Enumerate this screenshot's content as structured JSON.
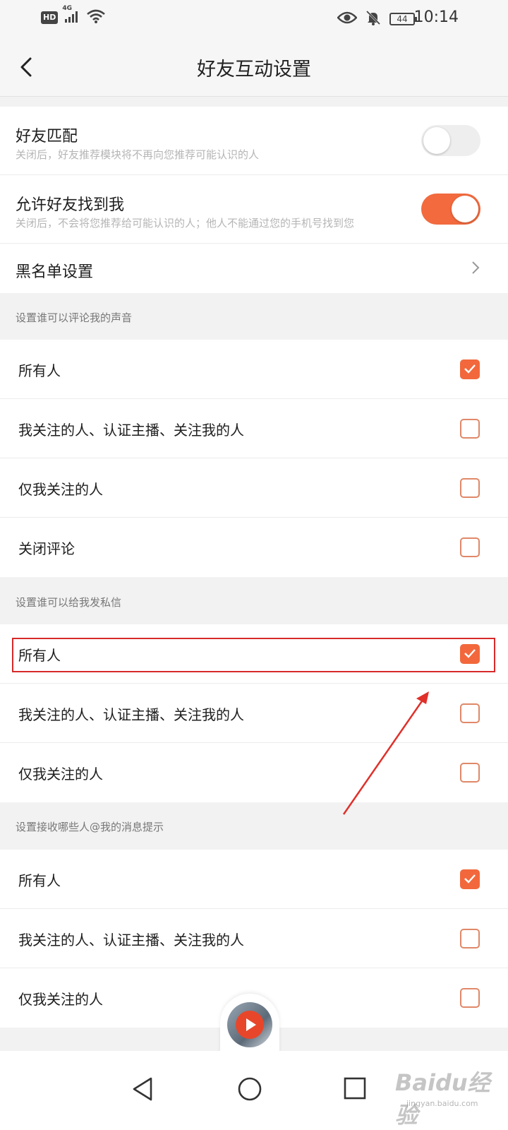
{
  "status_bar": {
    "hd": "HD",
    "network": "4G",
    "battery": "44",
    "time": "10:14"
  },
  "header": {
    "title": "好友互动设置"
  },
  "toggles": [
    {
      "title": "好友匹配",
      "subtitle": "关闭后，好友推荐模块将不再向您推荐可能认识的人",
      "enabled": false
    },
    {
      "title": "允许好友找到我",
      "subtitle": "关闭后，不会将您推荐给可能认识的人；他人不能通过您的手机号找到您",
      "enabled": true
    }
  ],
  "blacklist": {
    "label": "黑名单设置"
  },
  "sections": [
    {
      "label": "设置谁可以评论我的声音",
      "options": [
        {
          "label": "所有人",
          "checked": true
        },
        {
          "label": "我关注的人、认证主播、关注我的人",
          "checked": false
        },
        {
          "label": "仅我关注的人",
          "checked": false
        },
        {
          "label": "关闭评论",
          "checked": false
        }
      ]
    },
    {
      "label": "设置谁可以给我发私信",
      "options": [
        {
          "label": "所有人",
          "checked": true
        },
        {
          "label": "我关注的人、认证主播、关注我的人",
          "checked": false
        },
        {
          "label": "仅我关注的人",
          "checked": false
        }
      ]
    },
    {
      "label": "设置接收哪些人@我的消息提示",
      "options": [
        {
          "label": "所有人",
          "checked": true
        },
        {
          "label": "我关注的人、认证主播、关注我的人",
          "checked": false
        },
        {
          "label": "仅我关注的人",
          "checked": false
        }
      ]
    }
  ],
  "colors": {
    "accent": "#f26a3e",
    "annotation": "#d72a2a"
  },
  "watermark": {
    "main": "Baidu经验",
    "sub": "jingyan.baidu.com"
  }
}
